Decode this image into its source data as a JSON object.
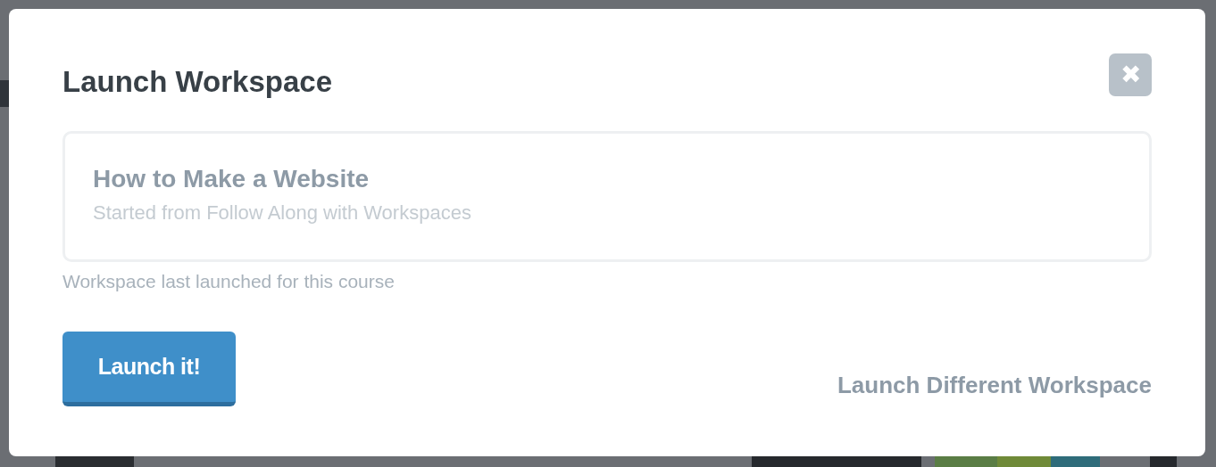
{
  "dialog": {
    "title": "Launch Workspace",
    "close_label": "✖",
    "workspace": {
      "title": "How to Make a Website",
      "subtitle": "Started from Follow Along with Workspaces"
    },
    "note": "Workspace last launched for this course",
    "primary_button": "Launch it!",
    "secondary_link": "Launch Different Workspace"
  }
}
